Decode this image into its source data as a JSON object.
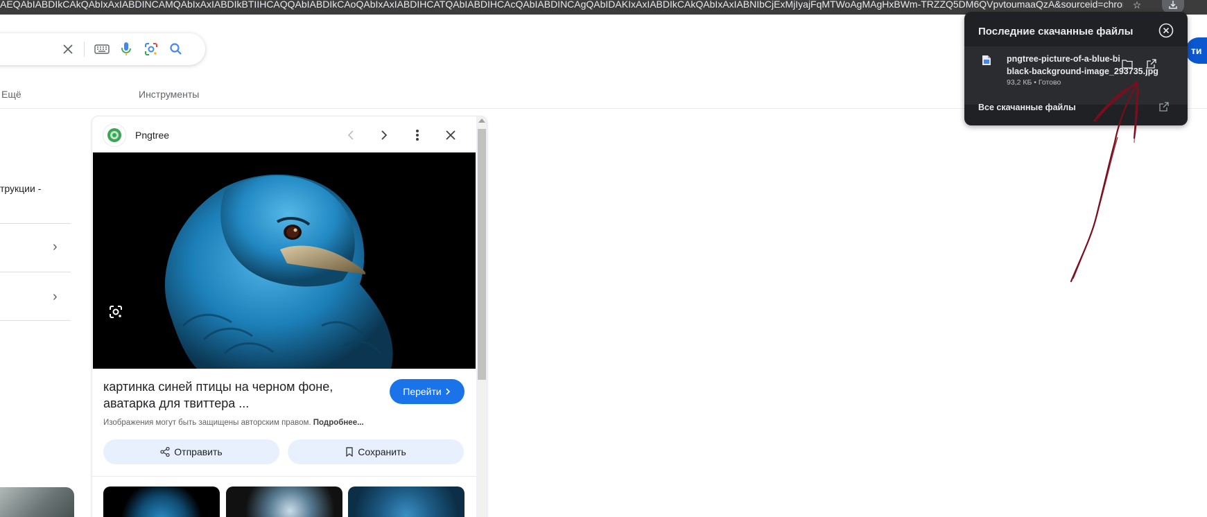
{
  "browser": {
    "url_fragment": "AEQAbIABDIkCAkQAbIxAxIABDINCAMQAbIxAxIABDIkBTIIHCAQQAbIABDIkCAoQAbIxAxIABDIHCATQAbIABDIHCAcQAbIABDINCAgQAbIDAKIxAxIABDIkCAkQAbIxAxIABNIbCjExMjIyajFqMTWoAgMAgHxBWm-TRZZQ5DM6QVpvtoumaaQzA&sourceid=chrome&ie=U..."
  },
  "search": {
    "tabs": {
      "more": "Ещё",
      "tools": "Инструменты"
    }
  },
  "left_column": {
    "snippet": "трукции -"
  },
  "preview": {
    "site_name": "Pngtree",
    "title_line1": "картинка синей птицы на черном фоне,",
    "title_line2": "аватарка для твиттера ...",
    "visit_label": "Перейти",
    "copyright_text": "Изображения могут быть защищены авторским правом.",
    "copyright_link": "Подробнее...",
    "share_label": "Отправить",
    "save_label": "Сохранить"
  },
  "downloads": {
    "title": "Последние скачанные файлы",
    "item": {
      "name_line1": "pngtree-picture-of-a-blue-bi",
      "name_line2": "black-background-image_29373",
      "name_tail": "5.jpg",
      "meta": "93,2 КБ • Готово"
    },
    "all_label": "Все скачанные файлы"
  },
  "edge_button_text": "ти",
  "colors": {
    "accent": "#1a73e8",
    "popup_bg": "#202124",
    "annotation": "#7a0e1e"
  }
}
